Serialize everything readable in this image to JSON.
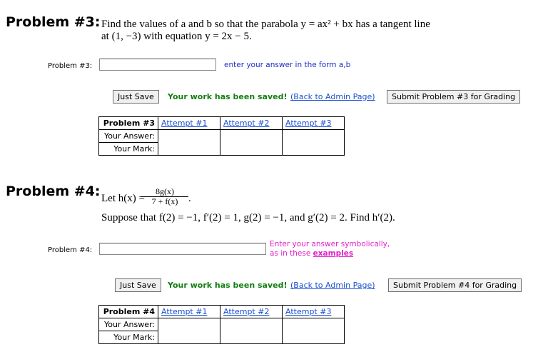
{
  "p3": {
    "title": "Problem #3:",
    "stmt1": "Find the values of a and b so that the parabola  y = ax² + bx  has a tangent line",
    "stmt2": "at (1, −3) with equation y = 2x − 5.",
    "field_label": "Problem #3:",
    "field_value": "",
    "hint": "enter your answer in the form a,b",
    "save_label": "Just Save",
    "saved_msg": "Your work has been saved!",
    "admin_link": "(Back to Admin Page)",
    "submit_label": "Submit Problem #3 for Grading",
    "table": {
      "head": "Problem #3",
      "attempts": [
        "Attempt #1",
        "Attempt #2",
        "Attempt #3"
      ],
      "answer_label": "Your Answer:",
      "mark_label": "Your Mark:"
    }
  },
  "p4": {
    "title": "Problem #4:",
    "let": "Let h(x) = ",
    "frac_num": "8g(x)",
    "frac_den": "7 + f(x)",
    "frac_end": ".",
    "stmt2": "Suppose that  f(2) = −1, f′(2) = 1, g(2) = −1, and g′(2) = 2.  Find h′(2).",
    "field_label": "Problem #4:",
    "field_value": "",
    "hint1": "Enter your answer symbolically,",
    "hint2_pre": "as in these ",
    "hint2_link": "examples",
    "save_label": "Just Save",
    "saved_msg": "Your work has been saved!",
    "admin_link": "(Back to Admin Page)",
    "submit_label": "Submit Problem #4 for Grading",
    "table": {
      "head": "Problem #4",
      "attempts": [
        "Attempt #1",
        "Attempt #2",
        "Attempt #3"
      ],
      "answer_label": "Your Answer:",
      "mark_label": "Your Mark:"
    }
  },
  "colors": {
    "saved": "#127e12",
    "link": "#1a4fd1",
    "hint_blue": "#1a2fc8",
    "hint_pink": "#e020c8"
  }
}
